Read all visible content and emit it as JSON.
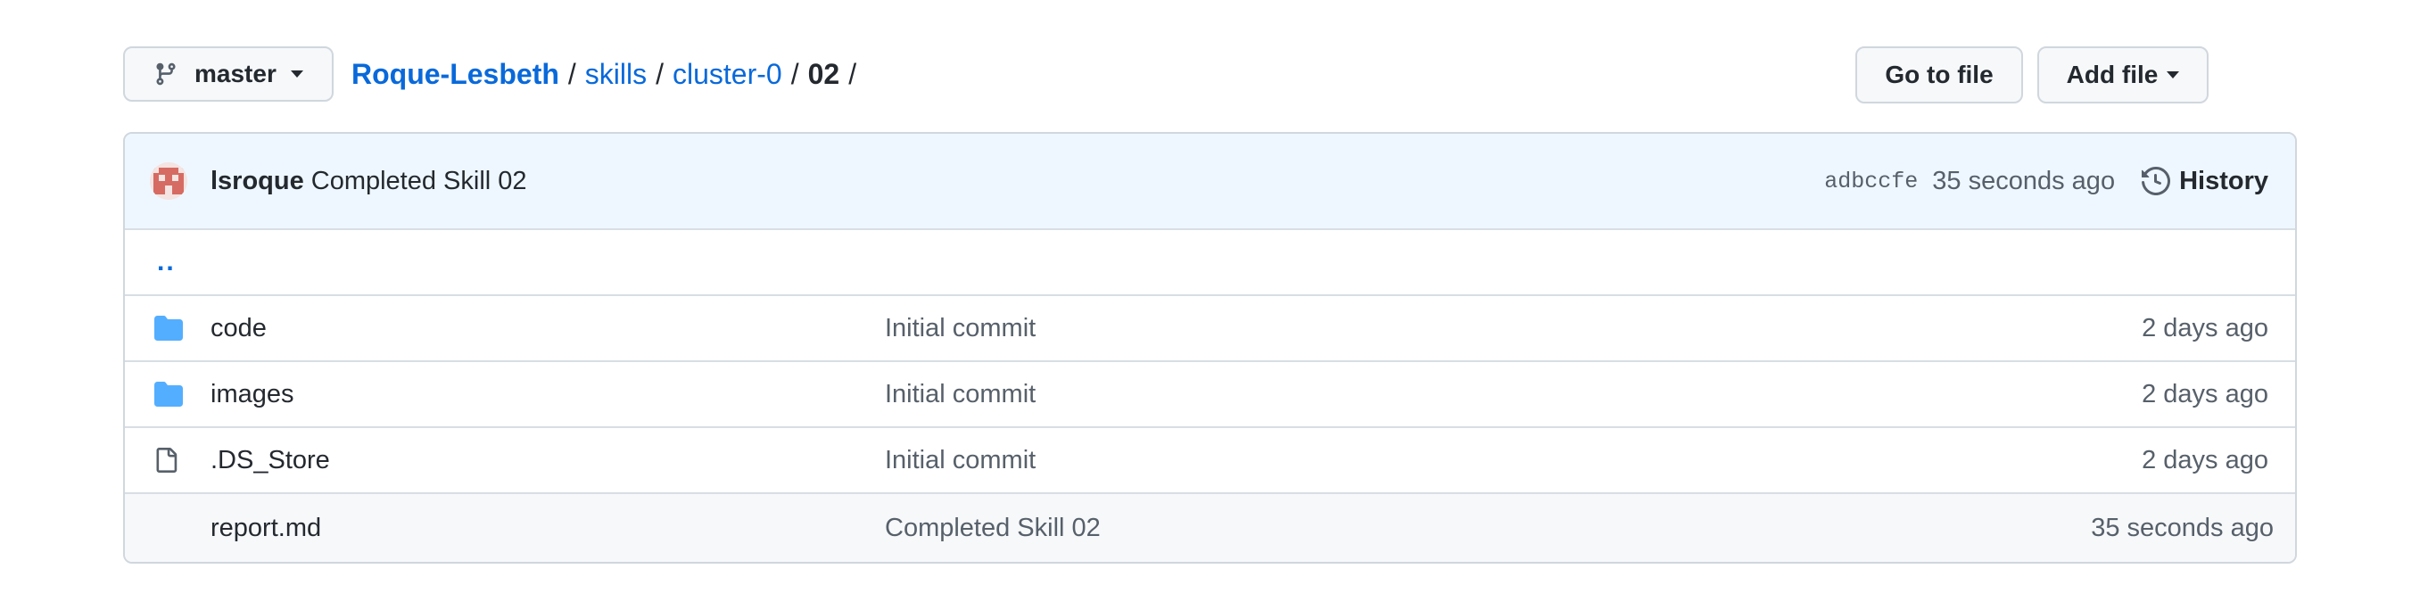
{
  "toolbar": {
    "branch_label": "master",
    "branch_icon": "git-branch-icon",
    "goto_label": "Go to file",
    "add_label": "Add file"
  },
  "breadcrumb": {
    "repo": "Roque-Lesbeth",
    "path": [
      "skills",
      "cluster-0"
    ],
    "current": "02",
    "separator": "/"
  },
  "latest_commit": {
    "author": "lsroque",
    "message": "Completed Skill 02",
    "sha": "adbccfe",
    "time": "35 seconds ago",
    "history_label": "History"
  },
  "parent_dir": "..",
  "files": [
    {
      "type": "folder",
      "name": "code",
      "commit": "Initial commit",
      "age": "2 days ago"
    },
    {
      "type": "folder",
      "name": "images",
      "commit": "Initial commit",
      "age": "2 days ago"
    },
    {
      "type": "file",
      "name": ".DS_Store",
      "commit": "Initial commit",
      "age": "2 days ago"
    },
    {
      "type": "file",
      "name": "report.md",
      "commit": "Completed Skill 02",
      "age": "35 seconds ago"
    }
  ],
  "colors": {
    "link": "#0969da",
    "folder": "#54aeff",
    "commit_header_bg": "#eef7ff",
    "border": "#d0d7de"
  }
}
